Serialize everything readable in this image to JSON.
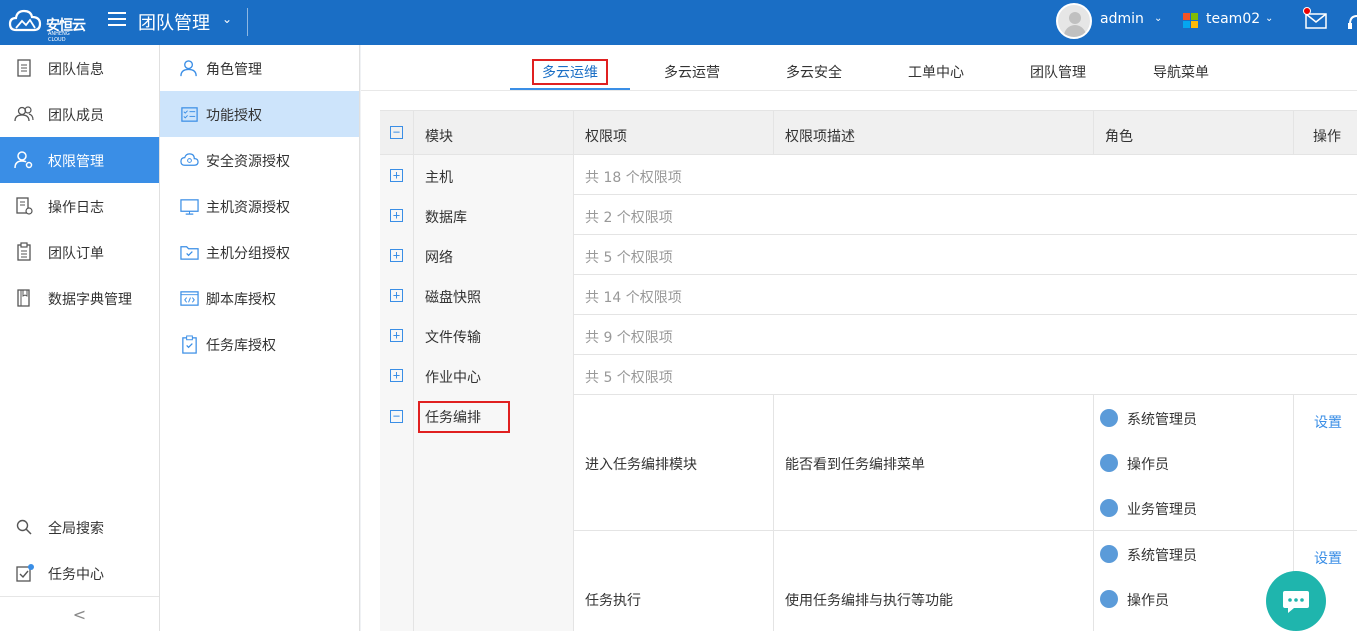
{
  "header": {
    "logo_text": "安恒云",
    "logo_sub": "ANHENG CLOUD",
    "app_title": "团队管理",
    "user_name": "admin",
    "team_name": "team02"
  },
  "leftnav": {
    "items": [
      {
        "label": "团队信息"
      },
      {
        "label": "团队成员"
      },
      {
        "label": "权限管理"
      },
      {
        "label": "操作日志"
      },
      {
        "label": "团队订单"
      },
      {
        "label": "数据字典管理"
      }
    ],
    "bottom": [
      {
        "label": "全局搜索"
      },
      {
        "label": "任务中心"
      }
    ],
    "collapse": "<"
  },
  "subnav": {
    "items": [
      {
        "label": "角色管理"
      },
      {
        "label": "功能授权"
      },
      {
        "label": "安全资源授权"
      },
      {
        "label": "主机资源授权"
      },
      {
        "label": "主机分组授权"
      },
      {
        "label": "脚本库授权"
      },
      {
        "label": "任务库授权"
      }
    ]
  },
  "tabs": [
    {
      "label": "多云运维"
    },
    {
      "label": "多云运营"
    },
    {
      "label": "多云安全"
    },
    {
      "label": "工单中心"
    },
    {
      "label": "团队管理"
    },
    {
      "label": "导航菜单"
    }
  ],
  "table": {
    "headers": {
      "module": "模块",
      "perm": "权限项",
      "desc": "权限项描述",
      "role": "角色",
      "op": "操作"
    },
    "collapsed_rows": [
      {
        "module": "主机",
        "count": "共 18 个权限项"
      },
      {
        "module": "数据库",
        "count": "共 2 个权限项"
      },
      {
        "module": "网络",
        "count": "共 5 个权限项"
      },
      {
        "module": "磁盘快照",
        "count": "共 14 个权限项"
      },
      {
        "module": "文件传输",
        "count": "共 9 个权限项"
      },
      {
        "module": "作业中心",
        "count": "共 5 个权限项"
      }
    ],
    "expanded": {
      "module": "任务编排",
      "items": [
        {
          "perm": "进入任务编排模块",
          "desc": "能否看到任务编排菜单",
          "roles": [
            "系统管理员",
            "操作员",
            "业务管理员"
          ],
          "op": "设置"
        },
        {
          "perm": "任务执行",
          "desc": "使用任务编排与执行等功能",
          "roles": [
            "系统管理员",
            "操作员"
          ],
          "op": "设置"
        }
      ]
    }
  },
  "colors": {
    "header_bg": "#1a6ec5",
    "nav_active": "#3a8ee6",
    "subnav_active": "#cde4fb",
    "link": "#3a8ee6",
    "highlight_box": "#e02020",
    "chat_button": "#1fb5ad"
  }
}
